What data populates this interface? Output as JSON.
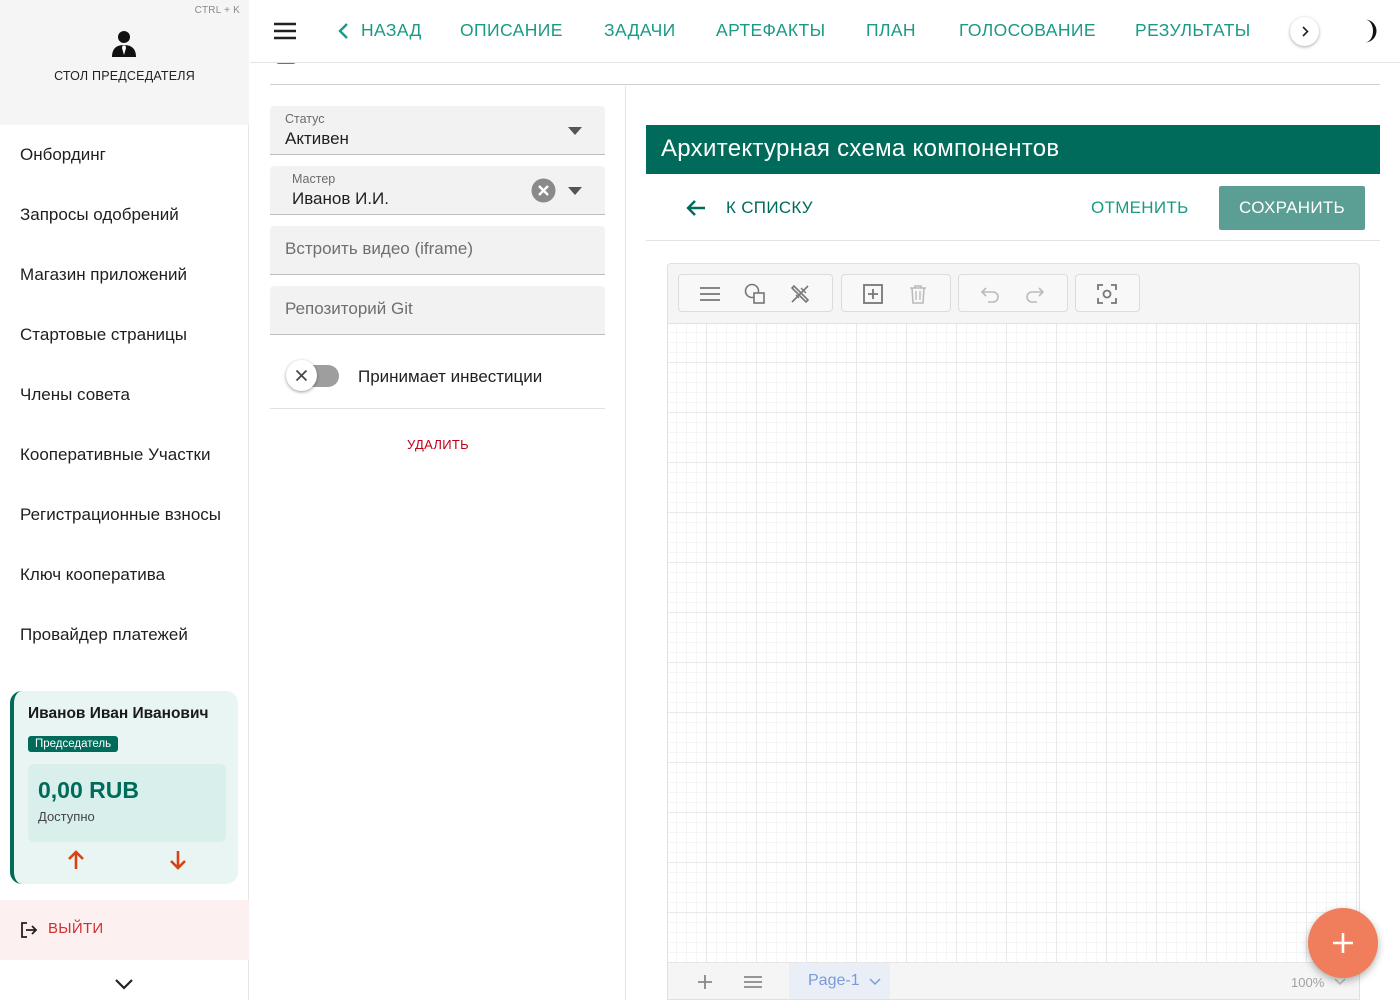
{
  "sidebar": {
    "hotkey": "CTRL + K",
    "title": "СТОЛ ПРЕДСЕДАТЕЛЯ",
    "items": [
      {
        "label": "Онбординг"
      },
      {
        "label": "Запросы одобрений"
      },
      {
        "label": "Магазин приложений"
      },
      {
        "label": "Стартовые страницы"
      },
      {
        "label": "Члены совета"
      },
      {
        "label": "Кооперативные Участки"
      },
      {
        "label": "Регистрационные взносы"
      },
      {
        "label": "Ключ кооператива"
      },
      {
        "label": "Провайдер платежей"
      }
    ],
    "user_card": {
      "name": "Иванов Иван Иванович",
      "role": "Председатель",
      "balance": "0,00 RUB",
      "balance_caption": "Доступно"
    },
    "logout_label": "ВЫЙТИ"
  },
  "topbar": {
    "tabs": [
      {
        "label": "НАЗАД"
      },
      {
        "label": "ОПИСАНИЕ"
      },
      {
        "label": "ЗАДАЧИ"
      },
      {
        "label": "АРТЕФАКТЫ"
      },
      {
        "label": "ПЛАН"
      },
      {
        "label": "ГОЛОСОВАНИЕ"
      },
      {
        "label": "РЕЗУЛЬТАТЫ"
      }
    ]
  },
  "form": {
    "status": {
      "label": "Статус",
      "value": "Активен"
    },
    "master": {
      "label": "Мастер",
      "value": "Иванов И.И."
    },
    "video": {
      "placeholder": "Встроить видео (iframe)"
    },
    "repo": {
      "placeholder": "Репозиторий Git"
    },
    "investments_toggle": {
      "label": "Принимает инвестиции",
      "checked": false
    },
    "delete_label": "УДАЛИТЬ"
  },
  "editor": {
    "title": "Архитектурная схема компонентов",
    "back_label": "К СПИСКУ",
    "cancel_label": "ОТМЕНИТЬ",
    "save_label": "СОХРАНИТЬ",
    "page_tab": "Page-1",
    "zoom": "100%"
  },
  "colors": {
    "primary": "#006b5a",
    "accent": "#1a9a84",
    "danger": "#c10015",
    "fab": "#f07d5c"
  }
}
